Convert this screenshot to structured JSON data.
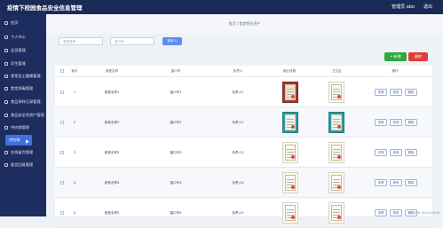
{
  "app": {
    "title": "疫情下校园食品安全信息管理",
    "user": "管理员 abo",
    "logout": "退出"
  },
  "sidebar": {
    "items": [
      {
        "label": "首页"
      },
      {
        "label": "个人中心"
      },
      {
        "label": "会员管理"
      },
      {
        "label": "学生管理"
      },
      {
        "label": "食堂员工健康管理"
      },
      {
        "label": "食堂消毒管理"
      },
      {
        "label": "食品采样记录管理"
      },
      {
        "label": "食品安全资质产管理"
      },
      {
        "label": "供应商管理"
      },
      {
        "label": "供应商",
        "active": true
      },
      {
        "label": "在线留言管理"
      },
      {
        "label": "留言回复管理"
      }
    ]
  },
  "breadcrumb": {
    "text": "首页 / 食堂营业资产"
  },
  "search": {
    "placeholder_1": "食堂名称",
    "placeholder_2": "窗口号",
    "button": "查询 Q"
  },
  "toolbar": {
    "add": "+ 新增",
    "delete": "删除"
  },
  "table": {
    "headers": [
      "索引",
      "食堂名称",
      "窗口号",
      "负责人",
      "营业执照",
      "卫生证",
      "操作"
    ],
    "rows": [
      {
        "index": "1",
        "name": "食堂名称1",
        "window": "窗口号1",
        "manager": "负责人1",
        "license": "cert-red",
        "hygiene": "cert-white"
      },
      {
        "index": "2",
        "name": "食堂名称2",
        "window": "窗口号2",
        "manager": "负责人2",
        "license": "cert-teal",
        "hygiene": "cert-teal"
      },
      {
        "index": "3",
        "name": "食堂名称3",
        "window": "窗口号3",
        "manager": "负责人3",
        "license": "cert-white",
        "hygiene": "cert-white"
      },
      {
        "index": "4",
        "name": "食堂名称4",
        "window": "窗口号4",
        "manager": "负责人4",
        "license": "cert-white",
        "hygiene": "cert-white"
      },
      {
        "index": "5",
        "name": "食堂名称5",
        "window": "窗口号5",
        "manager": "负责人5",
        "license": "cert-white",
        "hygiene": "cert-white"
      }
    ],
    "actions": [
      "详情",
      "修改",
      "删除"
    ]
  },
  "watermark": "CSDN @biye0808"
}
